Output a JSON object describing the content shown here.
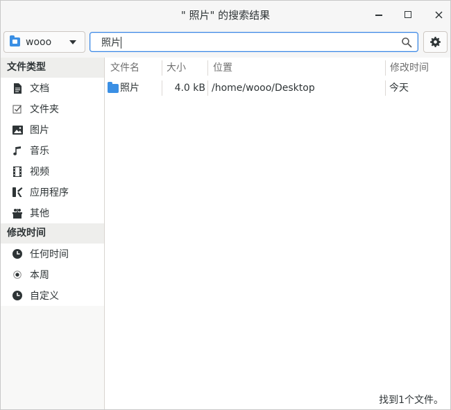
{
  "window": {
    "title": "\" 照片\" 的搜索结果",
    "controls": [
      "minimize",
      "maximize",
      "close"
    ]
  },
  "toolbar": {
    "location_label": "wooo",
    "search_value": "照片",
    "search_icon": "search-icon",
    "settings_icon": "gear-icon"
  },
  "sidebar": {
    "file_type_title": "文件类型",
    "file_types": [
      {
        "label": "文档",
        "icon": "document-icon"
      },
      {
        "label": "文件夹",
        "icon": "folder-check-icon"
      },
      {
        "label": "图片",
        "icon": "image-icon"
      },
      {
        "label": "音乐",
        "icon": "music-icon"
      },
      {
        "label": "视频",
        "icon": "video-icon"
      },
      {
        "label": "应用程序",
        "icon": "application-icon"
      },
      {
        "label": "其他",
        "icon": "other-icon"
      }
    ],
    "modified_title": "修改时间",
    "modified": [
      {
        "label": "任何时间",
        "icon": "clock-icon"
      },
      {
        "label": "本周",
        "icon": "radio-selected-icon"
      },
      {
        "label": "自定义",
        "icon": "clock-icon"
      }
    ]
  },
  "results": {
    "columns": {
      "name": "文件名",
      "size": "大小",
      "location": "位置",
      "modified": "修改时间"
    },
    "rows": [
      {
        "name": "照片",
        "size": "4.0 kB",
        "location": "/home/wooo/Desktop",
        "modified": "今天"
      }
    ]
  },
  "status": "找到1个文件。",
  "colors": {
    "accent": "#3584e4",
    "folder": "#3a8fe4",
    "sidebar_bg": "#f8f8f7",
    "section_bg": "#eeeeec"
  }
}
